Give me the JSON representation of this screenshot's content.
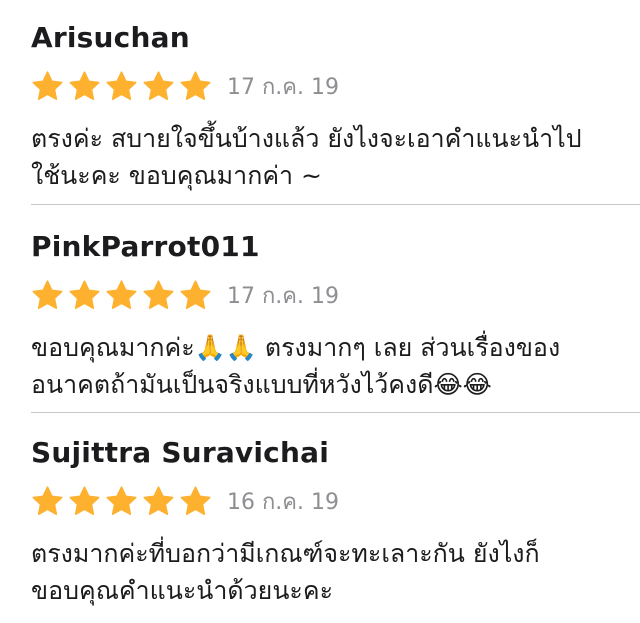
{
  "reviews": [
    {
      "author": "Arisuchan",
      "rating": 5,
      "date": "17 ก.ค. 19",
      "lines": [
        "ตรงค่ะ สบายใจขึ้นบ้างแล้ว ยังไงจะเอาคำแนะนำไป",
        "ใช้นะคะ ขอบคุณมากค่า ~"
      ]
    },
    {
      "author": "PinkParrot011",
      "rating": 5,
      "date": "17 ก.ค. 19",
      "lines": [
        "ขอบคุณมากค่ะ🙏🙏 ตรงมากๆ เลย ส่วนเรื่องของ",
        "อนาคตถ้ามันเป็นจริงแบบที่หวังไว้คงดี😂😂"
      ]
    },
    {
      "author": "Sujittra Suravichai",
      "rating": 5,
      "date": "16 ก.ค. 19",
      "lines": [
        "ตรงมากค่ะที่บอกว่ามีเกณฑ์จะทะเลาะกัน ยังไงก็",
        "ขอบคุณคำแนะนำด้วยนะคะ"
      ]
    }
  ],
  "colors": {
    "star": "#fdb12e",
    "divider": "#c8c7cc",
    "date": "#8e8e93"
  },
  "icons": {
    "star": "star-icon"
  }
}
